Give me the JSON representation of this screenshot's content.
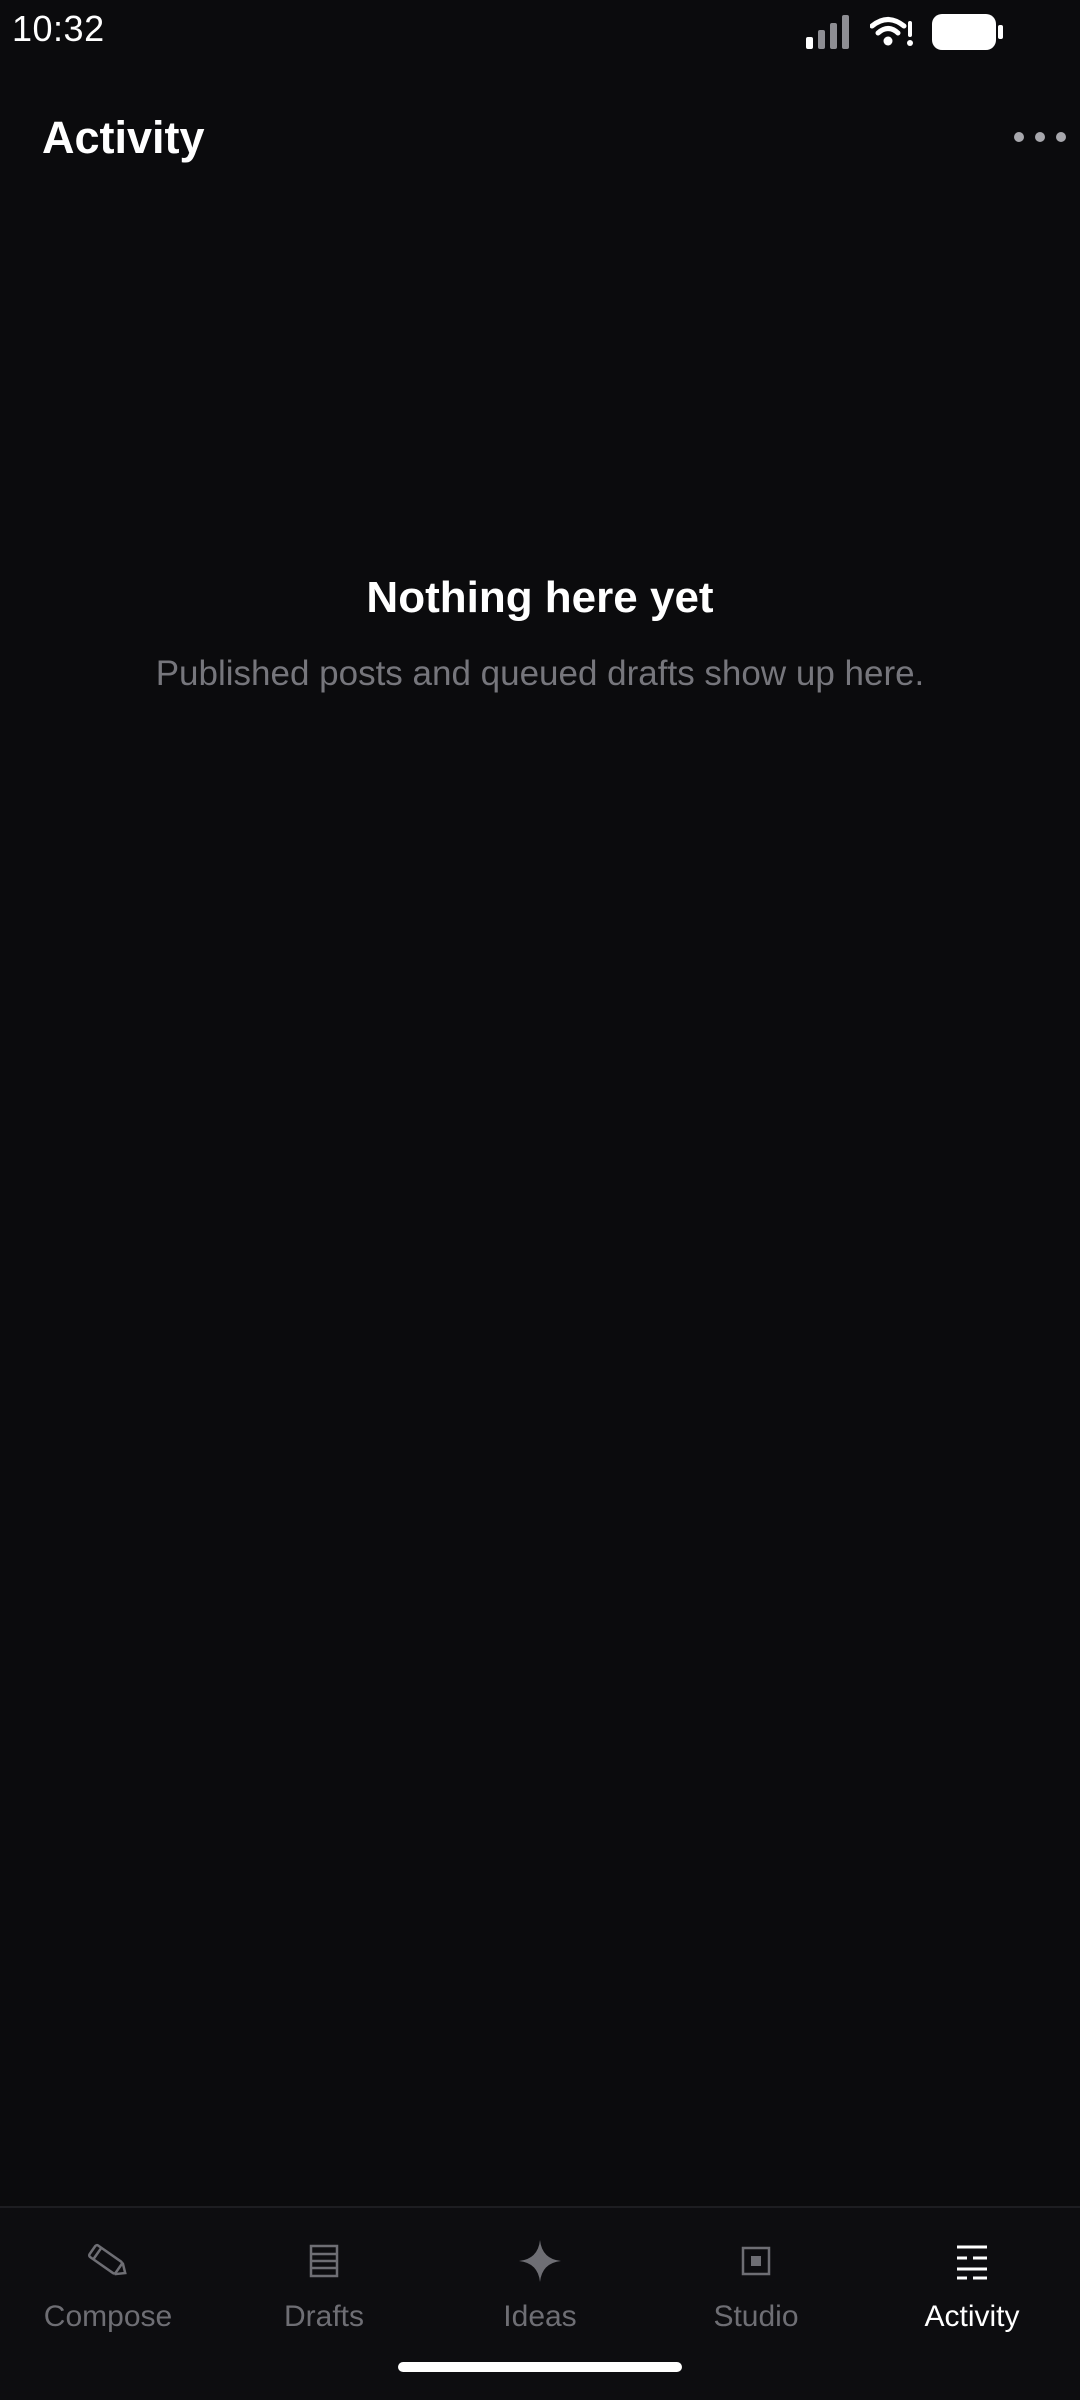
{
  "status_bar": {
    "time": "10:32",
    "icons": [
      "signal-icon",
      "wifi-icon",
      "battery-icon"
    ]
  },
  "header": {
    "title": "Activity",
    "more_icon": "more-horizontal-icon"
  },
  "empty_state": {
    "title": "Nothing here yet",
    "subtitle": "Published posts and queued drafts show up here."
  },
  "bottom_nav": {
    "active": "Activity",
    "items": [
      {
        "label": "Compose",
        "icon": "pencil-icon"
      },
      {
        "label": "Drafts",
        "icon": "drafts-list-icon"
      },
      {
        "label": "Ideas",
        "icon": "sparkle-icon"
      },
      {
        "label": "Studio",
        "icon": "studio-square-icon"
      },
      {
        "label": "Activity",
        "icon": "activity-lines-icon"
      }
    ]
  },
  "colors": {
    "background": "#0b0b0d",
    "text_primary": "#ffffff",
    "text_secondary": "#76767c",
    "nav_inactive": "#6e6e74"
  }
}
